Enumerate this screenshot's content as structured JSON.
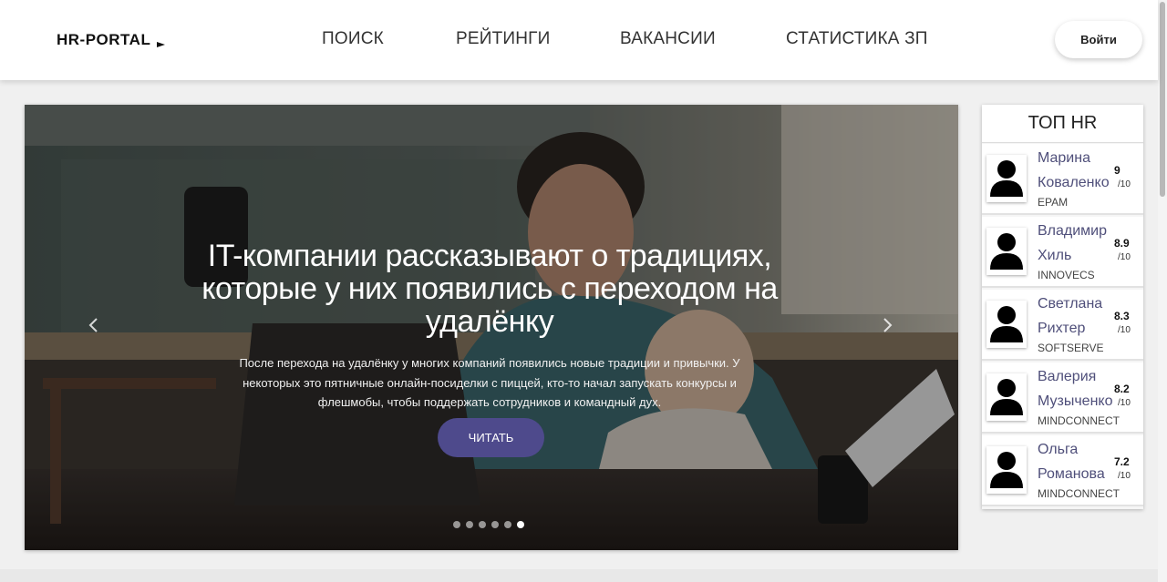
{
  "header": {
    "logo": "HR-PORTAL",
    "nav": [
      "ПОИСК",
      "РЕЙТИНГИ",
      "ВАКАНСИИ",
      "СТАТИСТИКА ЗП"
    ],
    "login_label": "Войти"
  },
  "slider": {
    "title": "IT-компании рассказывают о традициях, которые у них появились с переходом на удалёнку",
    "text": "После перехода на удалёнку у многих компаний появились новые традиции и привычки. У некоторых это пятничные онлайн-посиделки с пиццей, кто-то начал запускать конкурсы и флешмобы, чтобы поддержать сотрудников и командный дух.",
    "button_label": "ЧИТАТЬ",
    "slide_count": 6,
    "active_slide": 6,
    "prev_icon": "chevron-left-icon",
    "next_icon": "chevron-right-icon"
  },
  "top_hr": {
    "title": "ТОП HR",
    "items": [
      {
        "name": "Марина Коваленко",
        "company": "EPAM",
        "score": "9",
        "out_of": "/10"
      },
      {
        "name": "Владимир Хиль",
        "company": "INNOVECS",
        "score": "8.9",
        "out_of": "/10"
      },
      {
        "name": "Светлана Рихтер",
        "company": "SOFTSERVE",
        "score": "8.3",
        "out_of": "/10"
      },
      {
        "name": "Валерия Музыченко",
        "company": "MINDCONNECT",
        "score": "8.2",
        "out_of": "/10"
      },
      {
        "name": "Ольга Романова",
        "company": "MINDCONNECT",
        "score": "7.2",
        "out_of": "/10"
      }
    ]
  },
  "colors": {
    "accent_button": "#4e4a8c",
    "name_text": "#4f4f7a"
  }
}
